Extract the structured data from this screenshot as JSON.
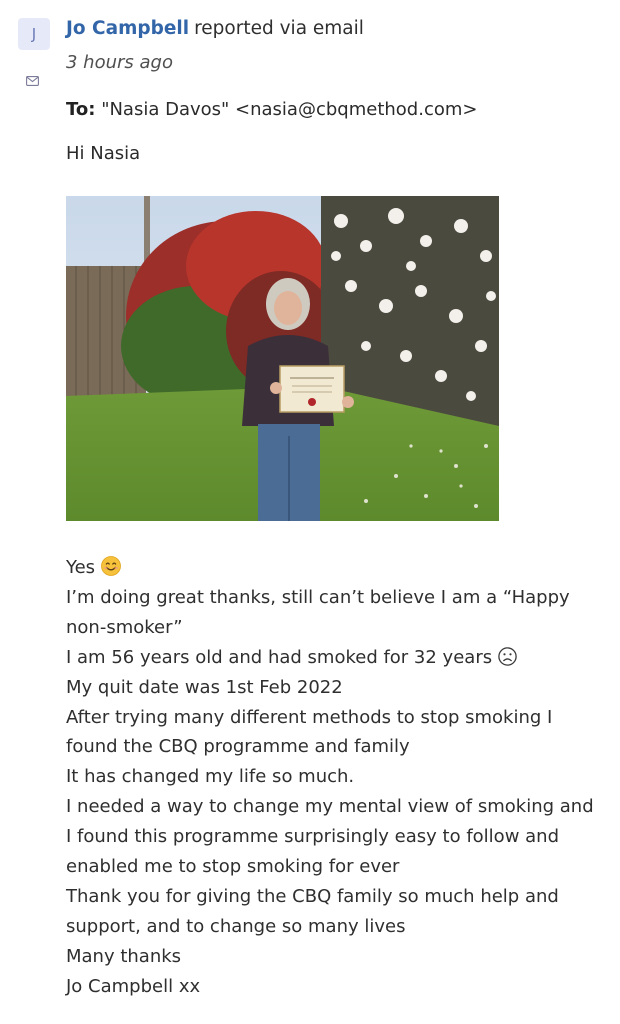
{
  "sender": {
    "avatar_initial": "J",
    "name": "Jo Campbell",
    "action": "reported via email",
    "time": "3 hours ago"
  },
  "recipient": {
    "label": "To:",
    "value": "\"Nasia Davos\" <nasia@cbqmethod.com>"
  },
  "greeting": "Hi Nasia",
  "body_lines": [
    "Yes",
    "I’m doing great thanks, still can’t believe I am a “Happy",
    "non-smoker”",
    "I am 56 years old and had smoked for 32 years",
    "My quit date was 1st Feb 2022",
    "After trying many different methods to stop smoking I",
    "found the CBQ programme and family",
    "It has changed my life so much.",
    "I needed a way to change my mental view of smoking and",
    "I found this programme surprisingly easy to follow and",
    "enabled me to stop smoking for ever",
    "Thank you for giving the CBQ family so much help and",
    "support, and to change so many lives",
    "Many thanks",
    "Jo Campbell xx"
  ],
  "icons": {
    "avatar": "avatar-icon",
    "mail": "envelope-icon",
    "smile": "smiling-face-emoji",
    "sad": "frowning-face-emoji"
  },
  "colors": {
    "author_link": "#3266a8",
    "avatar_bg": "#e6eaf8",
    "text": "#2f2f2f"
  }
}
